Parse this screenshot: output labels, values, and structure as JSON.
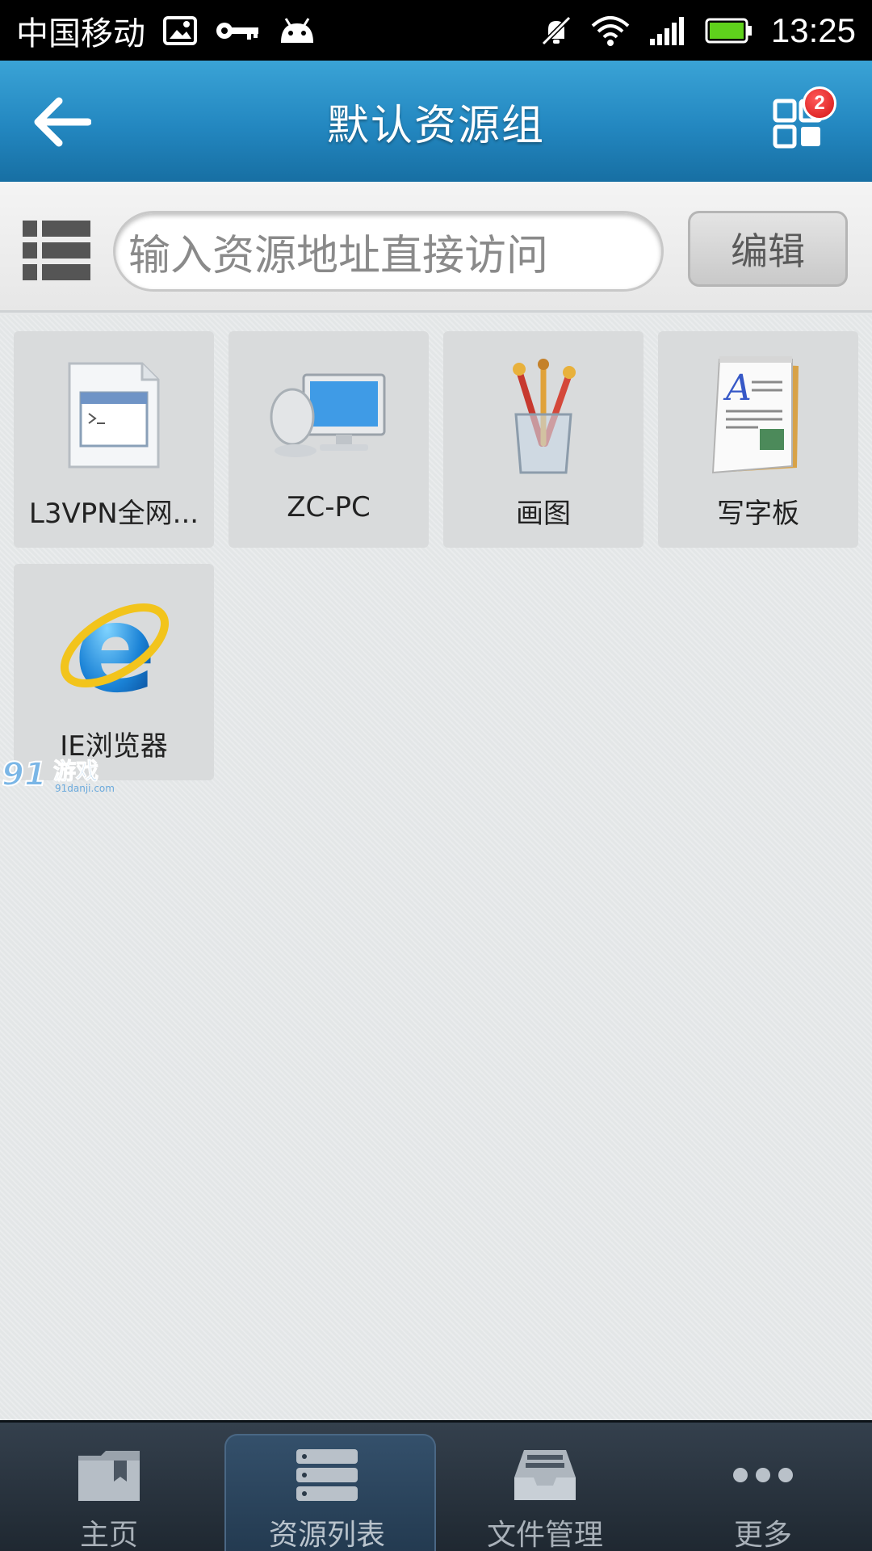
{
  "status_bar": {
    "carrier": "中国移动",
    "time": "13:25",
    "icons": [
      "image-notification-icon",
      "vpn-key-icon",
      "android-icon",
      "mute-icon",
      "wifi-icon",
      "signal-icon",
      "battery-icon"
    ]
  },
  "header": {
    "title": "默认资源组",
    "badge_count": "2"
  },
  "search": {
    "placeholder": "输入资源地址直接访问",
    "edit_label": "编辑"
  },
  "resources": [
    {
      "label": "L3VPN全网...",
      "icon": "application-window-icon"
    },
    {
      "label": "ZC-PC",
      "icon": "remote-desktop-icon"
    },
    {
      "label": "画图",
      "icon": "paint-brushes-icon"
    },
    {
      "label": "写字板",
      "icon": "wordpad-icon"
    },
    {
      "label": "IE浏览器",
      "icon": "ie-browser-icon"
    }
  ],
  "watermark": {
    "text": "91游戏",
    "subtext": "91danji.com"
  },
  "bottom_nav": {
    "items": [
      {
        "label": "主页",
        "icon": "home-folder-icon",
        "active": false
      },
      {
        "label": "资源列表",
        "icon": "resource-list-icon",
        "active": true
      },
      {
        "label": "文件管理",
        "icon": "file-tray-icon",
        "active": false
      },
      {
        "label": "更多",
        "icon": "more-dots-icon",
        "active": false
      }
    ]
  },
  "colors": {
    "title_bar": "#2387c0",
    "badge": "#d41414",
    "background": "#e3e6e7",
    "tile": "#d9dbdc",
    "bottom_nav": "#2a3540"
  }
}
